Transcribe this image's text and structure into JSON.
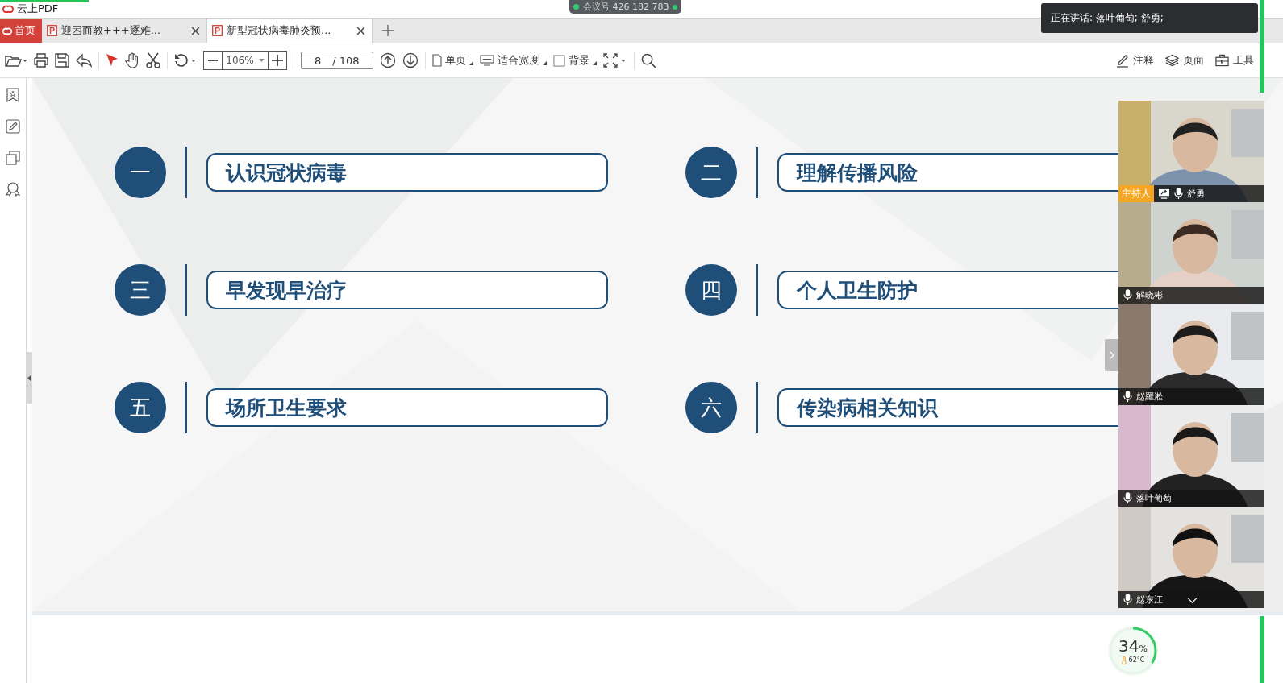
{
  "app": {
    "title": "云上PDF"
  },
  "meeting": {
    "id": "会议号 426 182 783"
  },
  "tabs": [
    {
      "label": "首页",
      "kind": "home",
      "selected": false
    },
    {
      "label": "迎困而教+++逐难...",
      "kind": "doc",
      "selected": false
    },
    {
      "label": "新型冠状病毒肺炎预...",
      "kind": "doc",
      "selected": true
    }
  ],
  "toolbar": {
    "zoom": "106%",
    "page": "8",
    "page_total": "/ 108",
    "view_buttons": [
      "单页",
      "适合宽度",
      "背景"
    ],
    "right_buttons": [
      "注释",
      "页面",
      "工具"
    ]
  },
  "toast": {
    "text": "正在讲话: 落叶葡萄; 舒勇;"
  },
  "slide": {
    "items": [
      {
        "number": "一",
        "title": "认识冠状病毒"
      },
      {
        "number": "二",
        "title": "理解传播风险"
      },
      {
        "number": "三",
        "title": "早发现早治疗"
      },
      {
        "number": "四",
        "title": "个人卫生防护"
      },
      {
        "number": "五",
        "title": "场所卫生要求"
      },
      {
        "number": "六",
        "title": "传染病相关知识"
      }
    ]
  },
  "participants": [
    {
      "name": "舒勇",
      "badge": "主持人",
      "sharing": true
    },
    {
      "name": "解晓彬",
      "sharing": false
    },
    {
      "name": "赵羅淞",
      "sharing": false
    },
    {
      "name": "落叶葡萄",
      "sharing": false
    },
    {
      "name": "赵东江",
      "sharing": false
    }
  ],
  "gauge": {
    "percent": "34",
    "unit": "%",
    "temperature": "62°C",
    "level": 0.34
  }
}
